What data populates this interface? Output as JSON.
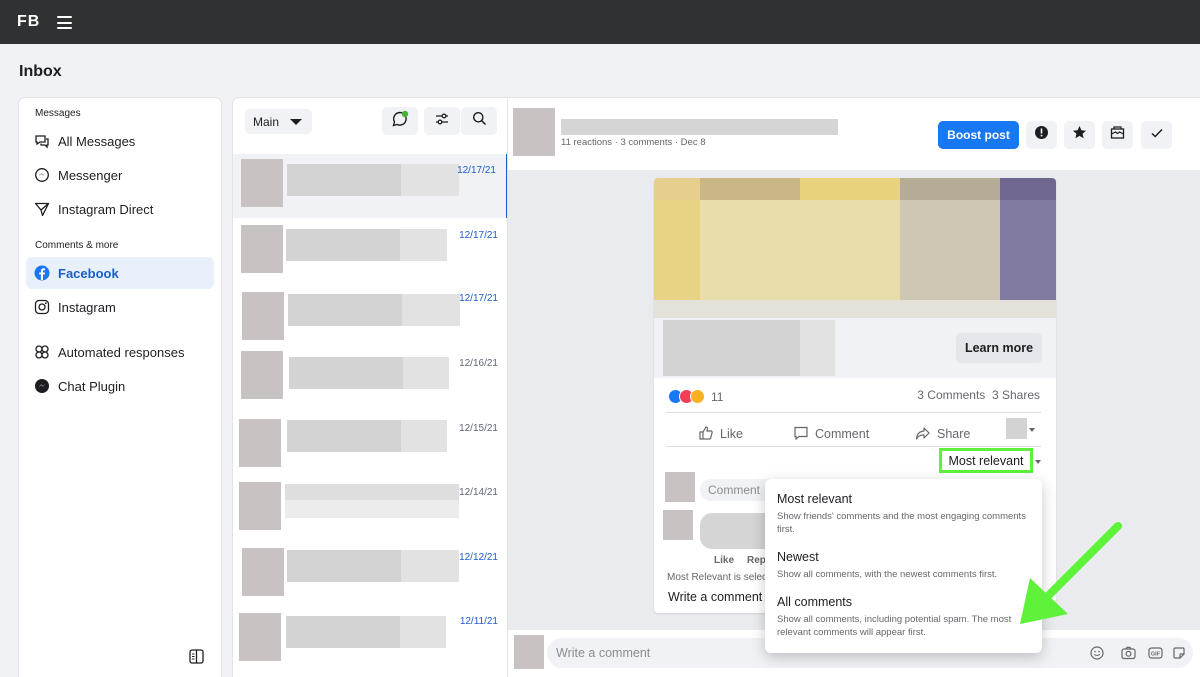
{
  "topbar": {
    "logo": "FB"
  },
  "page_title": "Inbox",
  "sidebar": {
    "section_messages": "Messages",
    "section_comments": "Comments & more",
    "items": [
      {
        "label": "All Messages",
        "icon": "chat-bubbles-icon"
      },
      {
        "label": "Messenger",
        "icon": "messenger-icon"
      },
      {
        "label": "Instagram Direct",
        "icon": "send-icon"
      },
      {
        "label": "Facebook",
        "icon": "facebook-icon",
        "active": true
      },
      {
        "label": "Instagram",
        "icon": "instagram-icon"
      },
      {
        "label": "Automated responses",
        "icon": "automation-icon"
      },
      {
        "label": "Chat Plugin",
        "icon": "messenger-icon"
      }
    ]
  },
  "msglist": {
    "dropdown_label": "Main",
    "rows": [
      {
        "date": "12/17/21",
        "unread": true
      },
      {
        "date": "12/17/21",
        "unread": true
      },
      {
        "date": "12/17/21",
        "unread": true
      },
      {
        "date": "12/16/21",
        "unread": false
      },
      {
        "date": "12/15/21",
        "unread": false
      },
      {
        "date": "12/14/21",
        "unread": false
      },
      {
        "date": "12/12/21",
        "unread": true
      },
      {
        "date": "12/11/21",
        "unread": true
      }
    ]
  },
  "post": {
    "meta": "11 reactions · 3 comments · Dec 8",
    "boost_label": "Boost post",
    "learn_more": "Learn more",
    "reaction_count": "11",
    "comments_count": "3 Comments",
    "shares_count": "3 Shares",
    "actions": {
      "like": "Like",
      "comment": "Comment",
      "share": "Share"
    },
    "sort_label": "Most relevant",
    "comment_placeholder": "Comment",
    "reply_like": "Like",
    "reply_reply": "Rep",
    "most_relevant_note": "Most Relevant is selec",
    "write_comment_inline": "Write a comment",
    "highlight_color": "#5ef23a"
  },
  "sort_menu": [
    {
      "title": "Most relevant",
      "desc": "Show friends' comments and the most engaging comments first."
    },
    {
      "title": "Newest",
      "desc": "Show all comments, with the newest comments first."
    },
    {
      "title": "All comments",
      "desc": "Show all comments, including potential spam. The most relevant comments will appear first."
    }
  ],
  "bottom_bar": {
    "placeholder": "Write a comment"
  },
  "colors": {
    "accent": "#1877f2",
    "arrow": "#5ef23a"
  }
}
